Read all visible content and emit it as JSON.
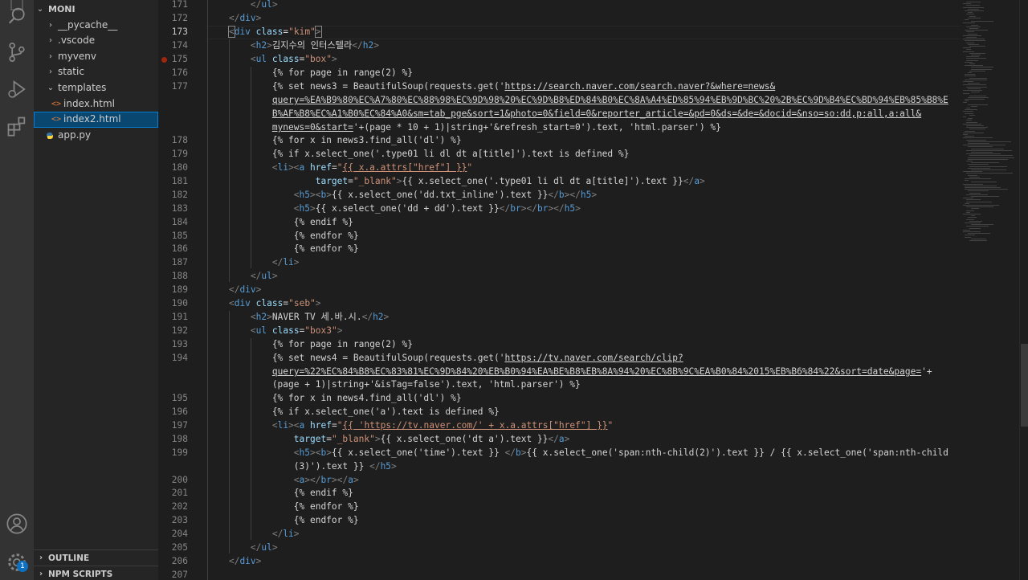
{
  "activity_bar": {
    "items": [
      "files-icon",
      "search-icon",
      "source-control-icon",
      "run-debug-icon",
      "extensions-icon"
    ],
    "bottom": [
      "account-icon",
      "settings-gear-icon"
    ],
    "settings_badge": "1"
  },
  "explorer": {
    "root": "MONI",
    "items": [
      {
        "label": "__pycache__",
        "type": "folder"
      },
      {
        "label": ".vscode",
        "type": "folder"
      },
      {
        "label": "myvenv",
        "type": "folder"
      },
      {
        "label": "static",
        "type": "folder"
      },
      {
        "label": "templates",
        "type": "folder-open"
      },
      {
        "label": "index.html",
        "type": "html"
      },
      {
        "label": "index2.html",
        "type": "html",
        "selected": true
      },
      {
        "label": "app.py",
        "type": "py"
      }
    ],
    "sections": [
      "OUTLINE",
      "NPM SCRIPTS"
    ]
  },
  "editor": {
    "line_numbers": [
      "171",
      "172",
      "173",
      "174",
      "175",
      "176",
      "177",
      "",
      "",
      "",
      "178",
      "179",
      "180",
      "181",
      "182",
      "183",
      "184",
      "185",
      "186",
      "187",
      "188",
      "189",
      "190",
      "191",
      "192",
      "193",
      "194",
      "",
      "",
      "195",
      "196",
      "197",
      "198",
      "199",
      "",
      "200",
      "201",
      "202",
      "203",
      "204",
      "205",
      "206",
      "207"
    ],
    "breakpoint_line": "175",
    "active_line": "173"
  }
}
